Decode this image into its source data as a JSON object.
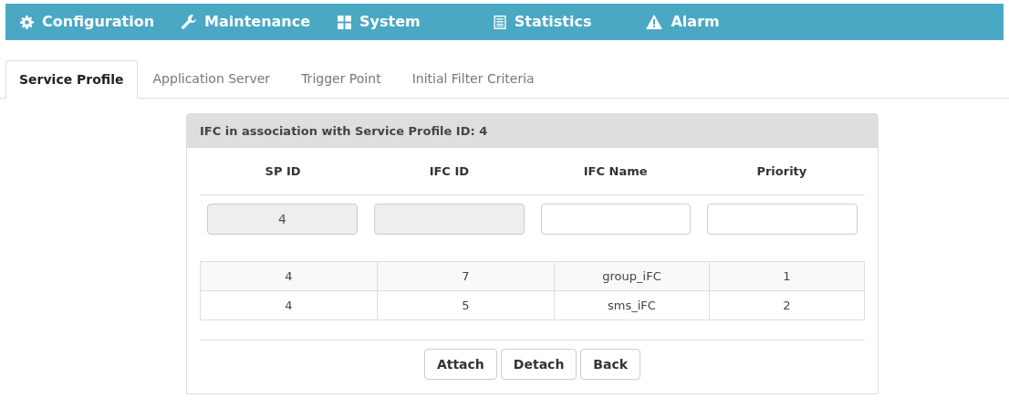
{
  "nav": [
    {
      "label": "Configuration",
      "kind": "gear"
    },
    {
      "label": "Maintenance",
      "kind": "wrench"
    },
    {
      "label": "System",
      "kind": "grid"
    },
    {
      "label": "Statistics",
      "kind": "list"
    },
    {
      "label": "Alarm",
      "kind": "warning"
    }
  ],
  "tabs": [
    {
      "label": "Service Profile",
      "selected": true
    },
    {
      "label": "Application Server",
      "selected": false
    },
    {
      "label": "Trigger Point",
      "selected": false
    },
    {
      "label": "Initial Filter Criteria",
      "selected": false
    }
  ],
  "panel": {
    "title": "IFC in association with Service Profile ID: 4",
    "columns": [
      "SP ID",
      "IFC ID",
      "IFC Name",
      "Priority"
    ],
    "fields": [
      {
        "value": "4",
        "disabled": true
      },
      {
        "disabled": true
      },
      {
        "disabled": false
      },
      {
        "disabled": false
      }
    ],
    "rows": [
      [
        "4",
        "7",
        "group_iFC",
        "1"
      ],
      [
        "4",
        "5",
        "sms_iFC",
        "2"
      ]
    ],
    "buttons": [
      "Attach",
      "Detach",
      "Back"
    ]
  }
}
